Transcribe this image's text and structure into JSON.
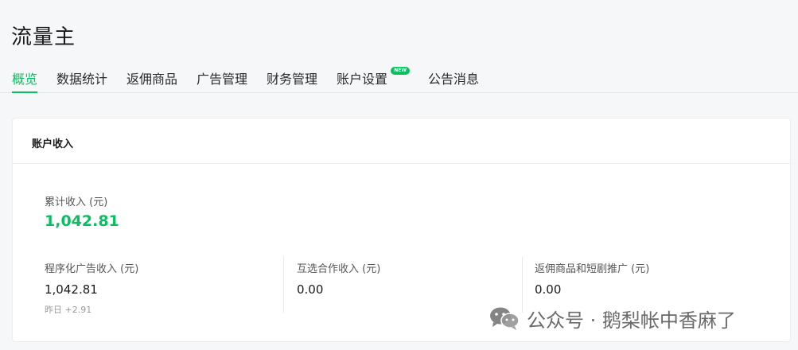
{
  "page": {
    "title": "流量主"
  },
  "tabs": [
    {
      "label": "概览",
      "active": true
    },
    {
      "label": "数据统计"
    },
    {
      "label": "返佣商品"
    },
    {
      "label": "广告管理"
    },
    {
      "label": "财务管理"
    },
    {
      "label": "账户设置",
      "badge": "NEW"
    },
    {
      "label": "公告消息"
    }
  ],
  "card": {
    "title": "账户收入",
    "total": {
      "label": "累计收入 (元)",
      "value": "1,042.81"
    },
    "metrics": [
      {
        "label": "程序化广告收入 (元)",
        "value": "1,042.81",
        "sub": "昨日 +2.91"
      },
      {
        "label": "互选合作收入 (元)",
        "value": "0.00"
      },
      {
        "label": "返佣商品和短剧推广 (元)",
        "value": "0.00"
      }
    ]
  },
  "watermark": {
    "text": "公众号 · 鹅梨帐中香麻了",
    "icon": "wechat-icon"
  },
  "colors": {
    "accent": "#07c160",
    "background": "#f6f7f8"
  }
}
